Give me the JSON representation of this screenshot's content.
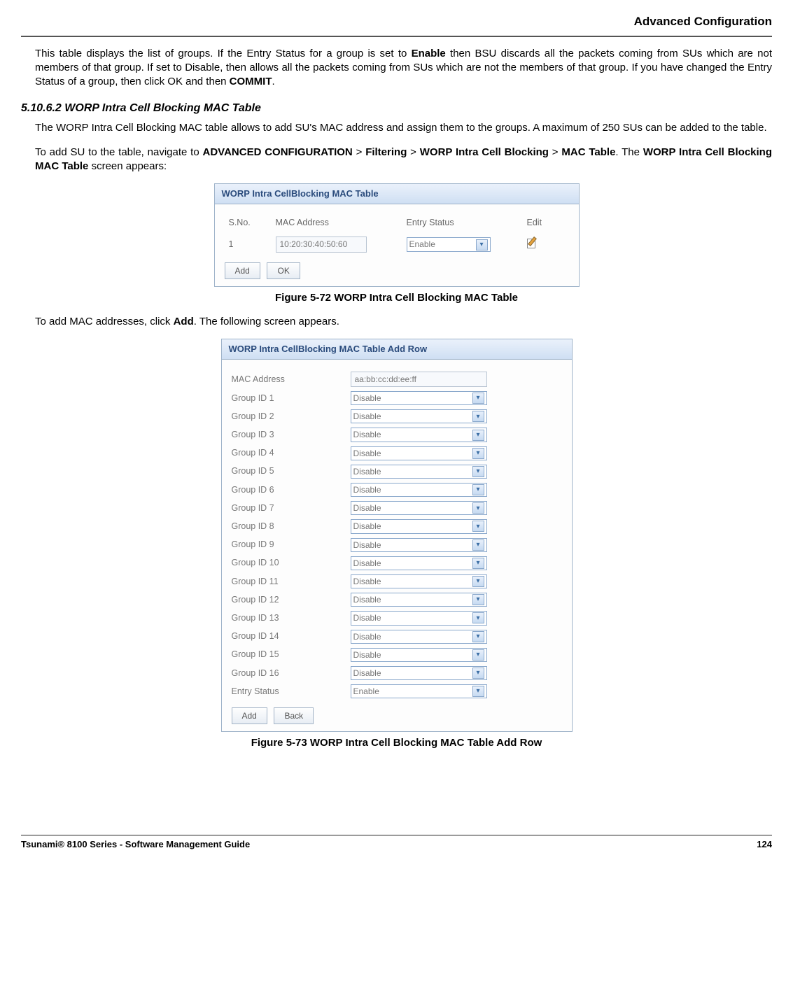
{
  "header": {
    "title": "Advanced Configuration"
  },
  "intro": {
    "p1a": "This table displays the list of groups. If the Entry Status for a group is set to ",
    "p1b": "Enable",
    "p1c": " then BSU discards all the packets coming from SUs which are not members of that group. If set to Disable, then allows all the packets coming from SUs which are not the members of that group. If you have changed the Entry Status of a group, then click OK and then ",
    "p1d": "COMMIT",
    "p1e": "."
  },
  "section": {
    "number": "5.10.6.2",
    "title": "WORP Intra Cell Blocking MAC Table"
  },
  "body": {
    "p2": "The WORP Intra Cell Blocking MAC table allows to add SU's MAC address and assign them to the groups. A maximum of 250 SUs can be added to the table.",
    "p3a": "To add SU to the table, navigate to ",
    "nav1": "ADVANCED CONFIGURATION",
    "gt": " > ",
    "nav2": "Filtering",
    "nav3": "WORP Intra Cell Blocking",
    "nav4": "MAC Table",
    "p3b": ". The ",
    "p3c": "WORP Intra Cell Blocking MAC Table",
    "p3d": " screen appears:"
  },
  "panel1": {
    "title": "WORP Intra CellBlocking MAC Table",
    "cols": {
      "c1": "S.No.",
      "c2": "MAC Address",
      "c3": "Entry Status",
      "c4": "Edit"
    },
    "row": {
      "sno": "1",
      "mac": "10:20:30:40:50:60",
      "status": "Enable"
    },
    "buttons": {
      "add": "Add",
      "ok": "OK"
    }
  },
  "fig1": "Figure 5-72 WORP Intra Cell Blocking MAC Table",
  "mid": {
    "p4a": "To add MAC addresses, click ",
    "p4b": "Add",
    "p4c": ". The following screen appears."
  },
  "panel2": {
    "title": "WORP Intra CellBlocking MAC Table Add Row",
    "mac_label": "MAC Address",
    "mac_value": "aa:bb:cc:dd:ee:ff",
    "groups": [
      {
        "label": "Group ID 1",
        "value": "Disable"
      },
      {
        "label": "Group ID 2",
        "value": "Disable"
      },
      {
        "label": "Group ID 3",
        "value": "Disable"
      },
      {
        "label": "Group ID 4",
        "value": "Disable"
      },
      {
        "label": "Group ID 5",
        "value": "Disable"
      },
      {
        "label": "Group ID 6",
        "value": "Disable"
      },
      {
        "label": "Group ID 7",
        "value": "Disable"
      },
      {
        "label": "Group ID 8",
        "value": "Disable"
      },
      {
        "label": "Group ID 9",
        "value": "Disable"
      },
      {
        "label": "Group ID 10",
        "value": "Disable"
      },
      {
        "label": "Group ID 11",
        "value": "Disable"
      },
      {
        "label": "Group ID 12",
        "value": "Disable"
      },
      {
        "label": "Group ID 13",
        "value": "Disable"
      },
      {
        "label": "Group ID 14",
        "value": "Disable"
      },
      {
        "label": "Group ID 15",
        "value": "Disable"
      },
      {
        "label": "Group ID 16",
        "value": "Disable"
      }
    ],
    "entry_status_label": "Entry Status",
    "entry_status_value": "Enable",
    "buttons": {
      "add": "Add",
      "back": "Back"
    }
  },
  "fig2": "Figure 5-73 WORP Intra Cell Blocking MAC Table Add Row",
  "footer": {
    "left": "Tsunami® 8100 Series - Software Management Guide",
    "right": "124"
  }
}
